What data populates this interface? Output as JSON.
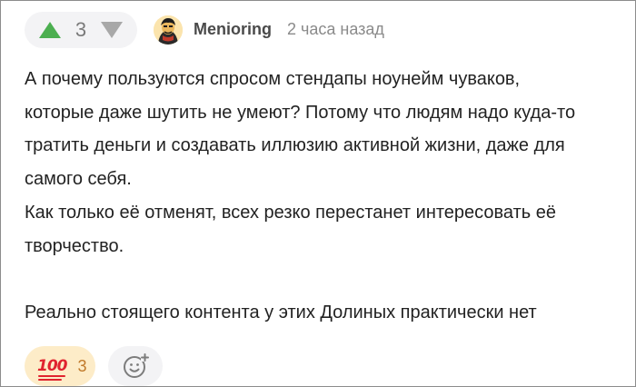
{
  "comment": {
    "vote": {
      "count": "3",
      "upvote_icon": "triangle-up-icon",
      "downvote_icon": "triangle-down-icon",
      "upvote_color": "#4caf50",
      "downvote_color": "#a8a8a8"
    },
    "author": {
      "avatar_icon": "avatar-image",
      "name": "Menioring",
      "time": "2 часа назад"
    },
    "body": {
      "lines": [
        "А почему пользуются спросом стендапы ноунейм чуваков,",
        "которые даже шутить не умеют? Потому что людям надо куда-то",
        "тратить деньги и создавать иллюзию активной жизни, даже для",
        "самого себя.",
        "Как только её отменят, всех резко перестанет интересовать её",
        "творчество.",
        "Реально стоящего контента у этих Долиных практически нет"
      ]
    },
    "reactions": {
      "items": [
        {
          "emoji": "100",
          "count": "3",
          "background": "#fdecc8"
        }
      ],
      "add_icon": "add-reaction-smiley-icon"
    }
  }
}
